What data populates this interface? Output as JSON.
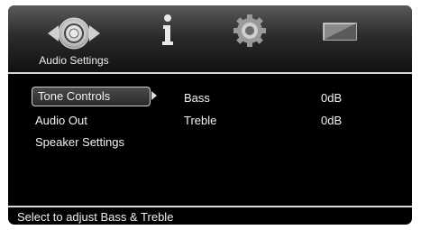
{
  "tabs": [
    {
      "label": "Audio Settings",
      "icon": "speaker-icon"
    },
    {
      "icon": "info-icon"
    },
    {
      "icon": "gear-icon"
    },
    {
      "icon": "screen-icon"
    }
  ],
  "menu": {
    "items": [
      "Tone Controls",
      "Audio Out",
      "Speaker Settings"
    ],
    "selected_index": 0
  },
  "details": [
    {
      "param": "Bass",
      "value": "0dB"
    },
    {
      "param": "Treble",
      "value": "0dB"
    }
  ],
  "status_text": "Select to adjust Bass & Treble"
}
